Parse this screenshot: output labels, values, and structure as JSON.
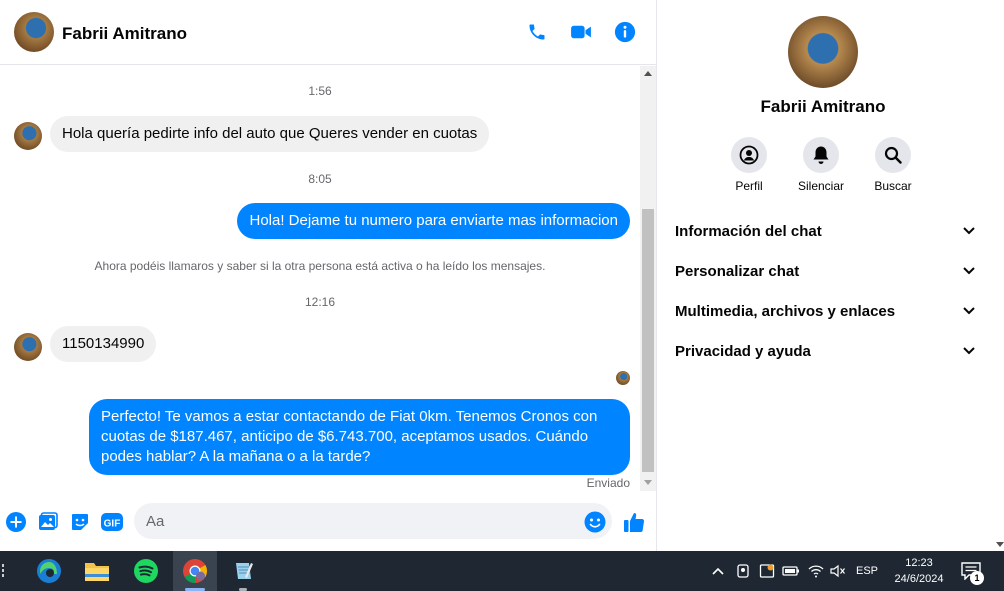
{
  "contact": {
    "name": "Fabrii Amitrano"
  },
  "messages": {
    "ts1": "1:56",
    "msg1": "Hola quería pedirte info del auto que Queres vender en cuotas",
    "ts2": "8:05",
    "msg2": "Hola! Dejame tu numero para enviarte mas informacion",
    "system_note": "Ahora podéis llamaros y saber si la otra persona está activa o ha leído los mensajes.",
    "ts3": "12:16",
    "msg3": "1150134990",
    "msg4_line1": "Perfecto! Te vamos a estar contactando de Fiat 0km. Tenemos Cronos con",
    "msg4_line2": "cuotas de $187.467, anticipo de $6.743.700, aceptamos usados. Cuándo",
    "msg4_line3": "podes hablar? A la mañana o a la tarde?",
    "status": "Enviado"
  },
  "composer": {
    "placeholder": "Aa",
    "gif_label": "GIF"
  },
  "panel": {
    "actions": {
      "profile": "Perfil",
      "mute": "Silenciar",
      "search": "Buscar"
    },
    "sections": {
      "chat_info": "Información del chat",
      "customize": "Personalizar chat",
      "media": "Multimedia, archivos y enlaces",
      "privacy": "Privacidad y ayuda"
    }
  },
  "taskbar": {
    "language": "ESP",
    "time": "12:23",
    "date": "24/6/2024",
    "notifications": "1",
    "apps": [
      "edge-icon",
      "file-explorer-icon",
      "spotify-icon",
      "chrome-icon",
      "notepad-icon"
    ]
  },
  "colors": {
    "accent": "#0084ff",
    "incoming_bubble": "#f0f0f0",
    "taskbar": "#1f2733"
  }
}
